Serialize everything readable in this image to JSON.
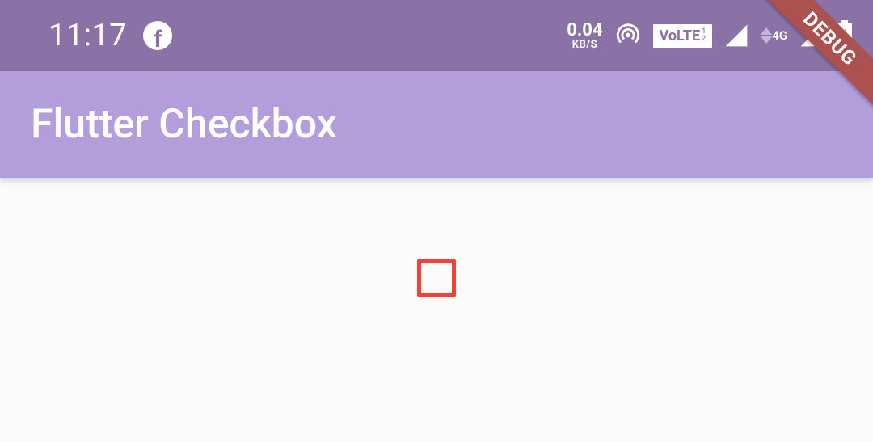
{
  "status_bar": {
    "time": "11:17",
    "network_speed_value": "0.04",
    "network_speed_unit": "KB/S",
    "volte_label": "VoLTE",
    "signal_label_4g": "4G"
  },
  "app_bar": {
    "title": "Flutter Checkbox"
  },
  "content": {
    "checkbox_checked": false
  },
  "debug_banner": {
    "label": "DEBUG"
  }
}
